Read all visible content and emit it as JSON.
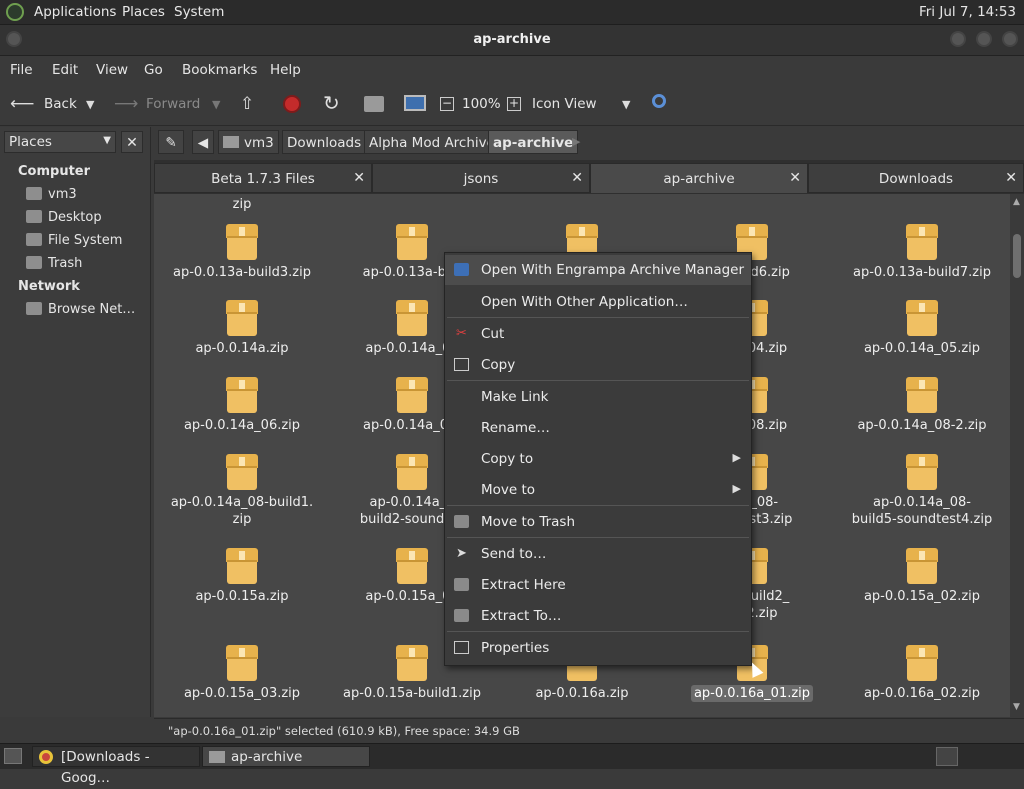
{
  "top_panel": {
    "menus": [
      "Applications",
      "Places",
      "System"
    ],
    "clock": "Fri Jul  7, 14:53"
  },
  "window": {
    "title": "ap-archive"
  },
  "menubar": [
    "File",
    "Edit",
    "View",
    "Go",
    "Bookmarks",
    "Help"
  ],
  "toolbar": {
    "back": "Back",
    "forward": "Forward",
    "zoom": "100%",
    "view_mode": "Icon View"
  },
  "sidebar": {
    "select": "Places",
    "sections": [
      {
        "title": "Computer",
        "items": [
          "vm3",
          "Desktop",
          "File System",
          "Trash"
        ]
      },
      {
        "title": "Network",
        "items": [
          "Browse Net…"
        ]
      }
    ]
  },
  "path": [
    "vm3",
    "Downloads",
    "Alpha Mod Archive",
    "ap-archive"
  ],
  "tabs": [
    {
      "label": "Beta 1.7.3 Files",
      "active": false
    },
    {
      "label": "jsons",
      "active": false
    },
    {
      "label": "ap-archive",
      "active": true
    },
    {
      "label": "Downloads",
      "active": false
    }
  ],
  "files": {
    "partial_top": "zip",
    "rows": [
      [
        "ap-0.0.13a-build3.zip",
        "ap-0.0.13a-buil",
        "",
        "a-build6.zip",
        "ap-0.0.13a-build7.zip"
      ],
      [
        "ap-0.0.14a.zip",
        "ap-0.0.14a_01",
        "",
        "14a_04.zip",
        "ap-0.0.14a_05.zip"
      ],
      [
        "ap-0.0.14a_06.zip",
        "ap-0.0.14a_06-",
        "",
        "14a_08.zip",
        "ap-0.0.14a_08-2.zip"
      ],
      [
        "ap-0.0.14a_08-build1.\nzip",
        "ap-0.0.14a_0\nbuild2-soundtes",
        "",
        "14a_08-\nundtest3.zip",
        "ap-0.0.14a_08-\nbuild5-soundtest4.zip"
      ],
      [
        "ap-0.0.15a.zip",
        "ap-0.0.15a_01",
        "",
        "_01-build2_\nest2.zip",
        "ap-0.0.15a_02.zip"
      ],
      [
        "ap-0.0.15a_03.zip",
        "ap-0.0.15a-build1.zip",
        "ap-0.0.16a.zip",
        "ap-0.0.16a_01.zip",
        "ap-0.0.16a_02.zip"
      ]
    ],
    "selected": "ap-0.0.16a_01.zip"
  },
  "status": "\"ap-0.0.16a_01.zip\" selected (610.9 kB), Free space: 34.9 GB",
  "context_menu": {
    "items": [
      {
        "label": "Open With Engrampa Archive Manager",
        "icon": "archive-manager-icon"
      },
      {
        "label": "Open With Other Application…",
        "icon": ""
      },
      {
        "label": "Cut",
        "icon": "scissors-icon"
      },
      {
        "label": "Copy",
        "icon": "copy-icon"
      },
      {
        "label": "Make Link",
        "icon": ""
      },
      {
        "label": "Rename…",
        "icon": ""
      },
      {
        "label": "Copy to",
        "icon": "",
        "submenu": true
      },
      {
        "label": "Move to",
        "icon": "",
        "submenu": true
      },
      {
        "label": "Move to Trash",
        "icon": "trash-icon"
      },
      {
        "label": "Send to…",
        "icon": "send-icon"
      },
      {
        "label": "Extract Here",
        "icon": "extract-icon"
      },
      {
        "label": "Extract To…",
        "icon": "extract-icon"
      },
      {
        "label": "Properties",
        "icon": "properties-icon"
      }
    ]
  },
  "taskbar": [
    {
      "label": "[Downloads - Goog…",
      "active": false
    },
    {
      "label": "ap-archive",
      "active": true
    }
  ]
}
